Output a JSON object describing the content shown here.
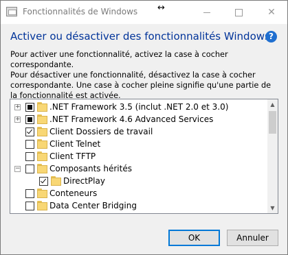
{
  "window": {
    "title": "Fonctionnalités de Windows",
    "cursor_glyph": "↔",
    "controls": {
      "minimize": "minimize",
      "maximize": "maximize",
      "close": "✕"
    }
  },
  "header": {
    "heading": "Activer ou désactiver des fonctionnalités Windows",
    "help_glyph": "?"
  },
  "description": {
    "line1": "Pour activer une fonctionnalité, activez la case à cocher correspondante.",
    "line2": "Pour désactiver une fonctionnalité, désactivez la case à cocher correspondante. Une case à cocher pleine signifie qu'une partie de la fonctionnalité est activée."
  },
  "features": [
    {
      "label": ".NET Framework 3.5 (inclut .NET 2.0 et 3.0)",
      "state": "partial",
      "expander": "+",
      "level": 0
    },
    {
      "label": ".NET Framework 4.6 Advanced Services",
      "state": "partial",
      "expander": "+",
      "level": 0
    },
    {
      "label": "Client Dossiers de travail",
      "state": "checked",
      "expander": "",
      "level": 0
    },
    {
      "label": "Client Telnet",
      "state": "unchecked",
      "expander": "",
      "level": 0
    },
    {
      "label": "Client TFTP",
      "state": "unchecked",
      "expander": "",
      "level": 0
    },
    {
      "label": "Composants hérités",
      "state": "unchecked",
      "expander": "−",
      "level": 0
    },
    {
      "label": "DirectPlay",
      "state": "checked",
      "expander": "",
      "level": 1
    },
    {
      "label": "Conteneurs",
      "state": "unchecked",
      "expander": "",
      "level": 0
    },
    {
      "label": "Data Center Bridging",
      "state": "unchecked",
      "expander": "",
      "level": 0
    }
  ],
  "scrollbar": {
    "up": "▲",
    "down": "▼"
  },
  "buttons": {
    "ok": "OK",
    "cancel": "Annuler"
  },
  "colors": {
    "heading": "#003399",
    "help": "#1f6fd0",
    "focus_border": "#0078d7",
    "folder": "#f8d775"
  }
}
